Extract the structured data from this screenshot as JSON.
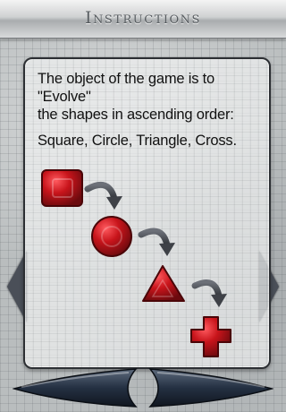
{
  "header": {
    "title": "Instructions"
  },
  "instructions": {
    "intro": "The object of the game is to \"Evolve\"\nthe shapes in ascending order:",
    "shape_list": "Square, Circle, Triangle, Cross."
  },
  "colors": {
    "shape_red": "#c8141b",
    "shape_dark": "#6b0a0e",
    "arrow_gray": "#3e4147",
    "nav_dark": "#1f2a38"
  },
  "shapes": [
    "square",
    "circle",
    "triangle",
    "cross"
  ],
  "icons": {
    "prev": "previous-arrow-icon",
    "next": "next-arrow-icon",
    "evolve": "curved-arrow-icon"
  }
}
